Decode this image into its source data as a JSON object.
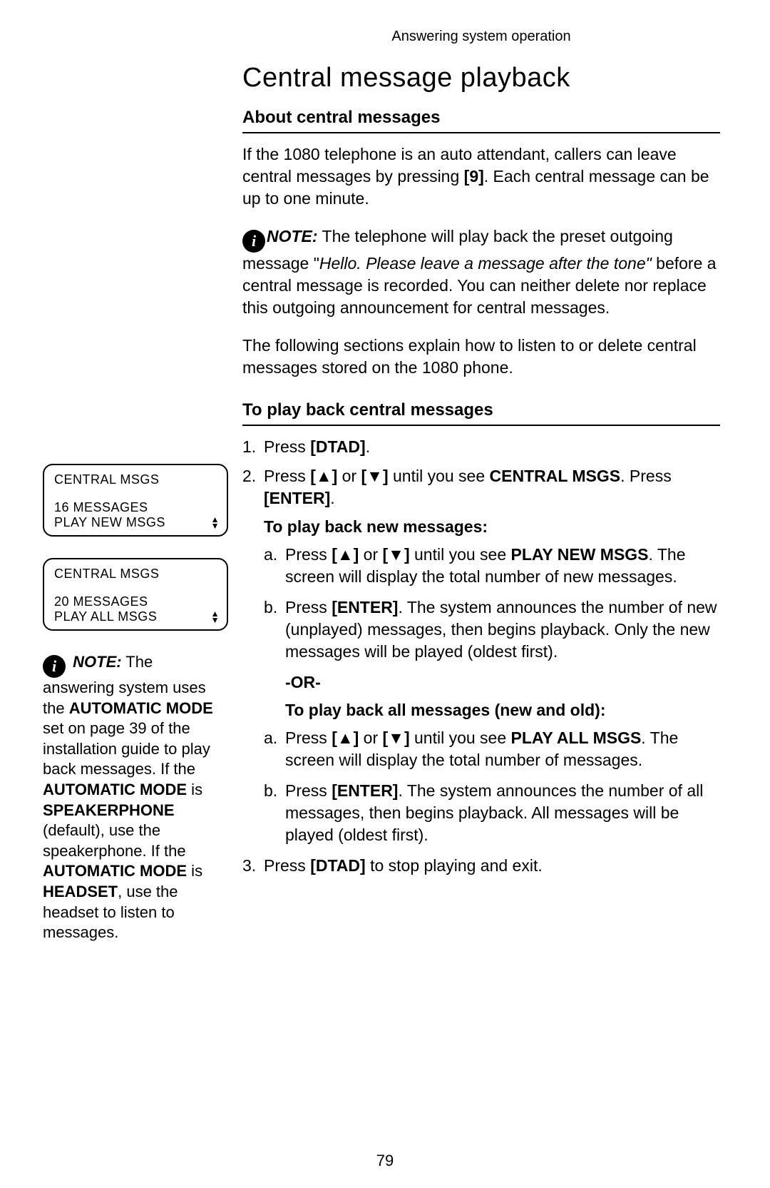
{
  "header": "Answering system operation",
  "title": "Central message playback",
  "section1_heading": "About central messages",
  "para1_a": "If the 1080 telephone is an auto attendant, callers can leave central messages by pressing ",
  "para1_key": "[9]",
  "para1_b": ". Each central message can be up to one minute.",
  "note1_label": "NOTE:",
  "note1_a": " The telephone will play back the preset outgoing message \"",
  "note1_italic": "Hello. Please leave a message after the tone\"",
  "note1_b": " before a central message is recorded. You can neither delete nor replace this outgoing announcement for central messages.",
  "para2": "The following sections explain how to listen to or delete central messages stored on the 1080 phone.",
  "section2_heading": "To play back central messages",
  "step1_a": "Press ",
  "step1_key": "[DTAD]",
  "step1_b": ".",
  "step2_a": "Press ",
  "step2_key1": "[▲]",
  "step2_b": " or ",
  "step2_key2": "[▼]",
  "step2_c": " until you see ",
  "step2_bold": "CENTRAL MSGS",
  "step2_d": ". Press ",
  "step2_key3": "[ENTER]",
  "step2_e": ".",
  "sub_heading_new": "To play back new messages:",
  "new_a_a": "Press ",
  "new_a_key1": "[▲]",
  "new_a_b": " or ",
  "new_a_key2": "[▼]",
  "new_a_c": " until you see ",
  "new_a_bold": "PLAY NEW MSGS",
  "new_a_d": ". The screen will display the total number of new messages.",
  "new_b_a": "Press ",
  "new_b_key": "[ENTER]",
  "new_b_b": ". The system announces the number of new (unplayed) messages, then begins playback. Only the new messages will be played (oldest first).",
  "or_text": "-OR-",
  "sub_heading_all": "To play back all messages (new and old):",
  "all_a_a": "Press ",
  "all_a_key1": "[▲]",
  "all_a_b": " or ",
  "all_a_key2": "[▼]",
  "all_a_c": " until you see ",
  "all_a_bold": "PLAY ALL MSGS",
  "all_a_d": ". The screen will display the total number of messages.",
  "all_b_a": "Press ",
  "all_b_key": "[ENTER]",
  "all_b_b": ". The system announces the number of all messages, then begins playback. All messages will be played (oldest first).",
  "step3_a": "Press ",
  "step3_key": "[DTAD]",
  "step3_b": " to stop playing and exit.",
  "lcd1_top": "CENTRAL MSGS",
  "lcd1_mid": "16 MESSAGES",
  "lcd1_bot": "PLAY NEW MSGS",
  "lcd2_top": "CENTRAL MSGS",
  "lcd2_mid": "20 MESSAGES",
  "lcd2_bot": "PLAY ALL MSGS",
  "side_note_label": "NOTE:",
  "side_note_a": " The answering system uses the ",
  "side_note_b1": "AUTOMATIC MODE",
  "side_note_b": " set on page 39 of the installation guide to play back messages. If the ",
  "side_note_b2": "AUTOMATIC MODE",
  "side_note_c": " is ",
  "side_note_b3": "SPEAKERPHONE",
  "side_note_d": " (default), use the speakerphone. If the ",
  "side_note_b4": "AUTOMATIC MODE",
  "side_note_e": " is ",
  "side_note_b5": "HEADSET",
  "side_note_f": ", use the headset to listen to messages.",
  "page_num": "79"
}
